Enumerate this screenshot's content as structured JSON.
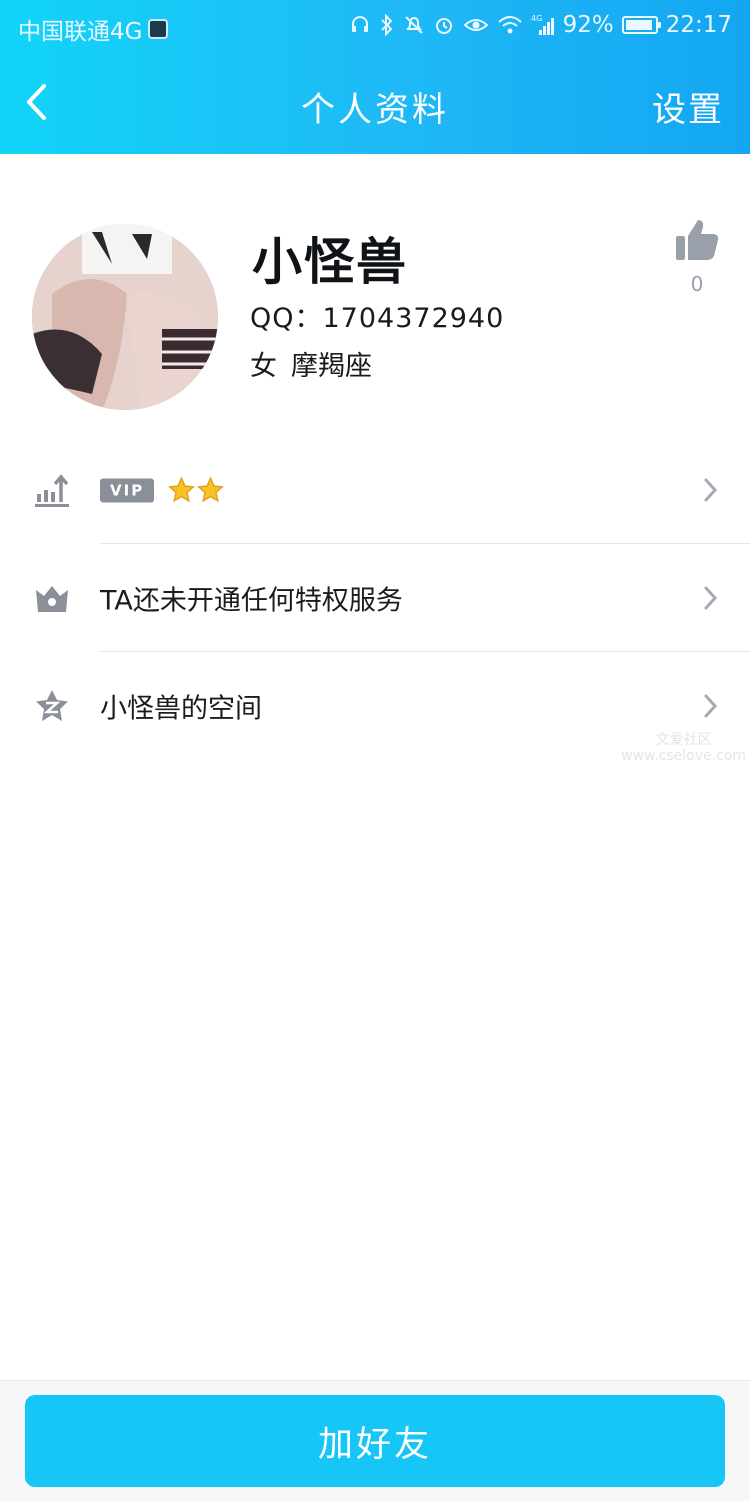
{
  "status_bar": {
    "carrier": "中国联通4G",
    "battery_text": "92%",
    "battery_level": 0.92,
    "network_type": "4G",
    "time": "22:17",
    "icons": [
      "headset-icon",
      "bluetooth-icon",
      "mute-icon",
      "alarm-icon",
      "eye-icon",
      "wifi-icon",
      "signal-icon",
      "battery-icon"
    ]
  },
  "nav": {
    "back_icon": "chevron-left-icon",
    "title": "个人资料",
    "right_label": "设置"
  },
  "profile": {
    "name": "小怪兽",
    "qq_line": "QQ：1704372940",
    "gender": "女",
    "zodiac": "摩羯座",
    "like_icon": "thumbs-up-icon",
    "like_count": "0"
  },
  "menu": {
    "vip": {
      "icon": "level-up-icon",
      "badge": "VIP",
      "stars": 2
    },
    "privilege": {
      "icon": "crown-icon",
      "label": "TA还未开通任何特权服务"
    },
    "space": {
      "icon": "qzone-star-icon",
      "label": "小怪兽的空间"
    }
  },
  "watermark": {
    "line1": "文爱社区",
    "line2": "www.cselove.com"
  },
  "bottom": {
    "add_friend_label": "加好友"
  },
  "colors": {
    "header_start": "#12d4f8",
    "header_end": "#13a6f2",
    "button": "#16c6f7",
    "icon_gray": "#8b8f98"
  }
}
